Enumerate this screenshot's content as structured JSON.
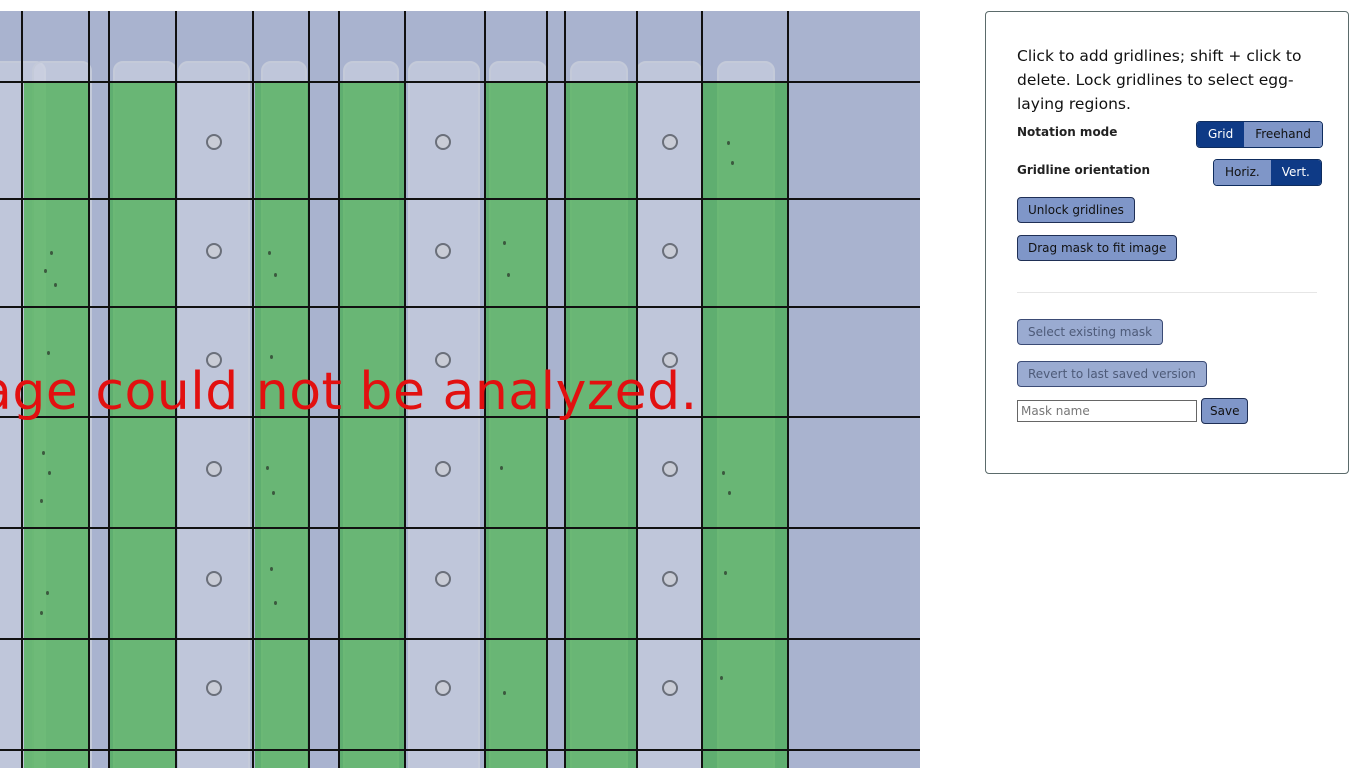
{
  "image_area": {
    "error_message": "age could not be analyzed."
  },
  "panel": {
    "instructions": "Click to add gridlines; shift + click to delete. Lock gridlines to select egg-laying regions.",
    "notation_mode": {
      "label": "Notation mode",
      "options": [
        "Grid",
        "Freehand"
      ],
      "selected": "Grid"
    },
    "gridline_orientation": {
      "label": "Gridline orientation",
      "options": [
        "Horiz.",
        "Vert."
      ],
      "selected": "Vert."
    },
    "unlock_gridlines_label": "Unlock gridlines",
    "drag_mask_label": "Drag mask to fit image",
    "select_existing_mask_label": "Select existing mask",
    "revert_label": "Revert to last saved version",
    "mask_name_placeholder": "Mask name",
    "save_label": "Save"
  },
  "colors": {
    "accent_active": "#0e3a86",
    "button": "#7f96c8",
    "mask_green": "#22aa22",
    "error_text": "#e21010"
  }
}
